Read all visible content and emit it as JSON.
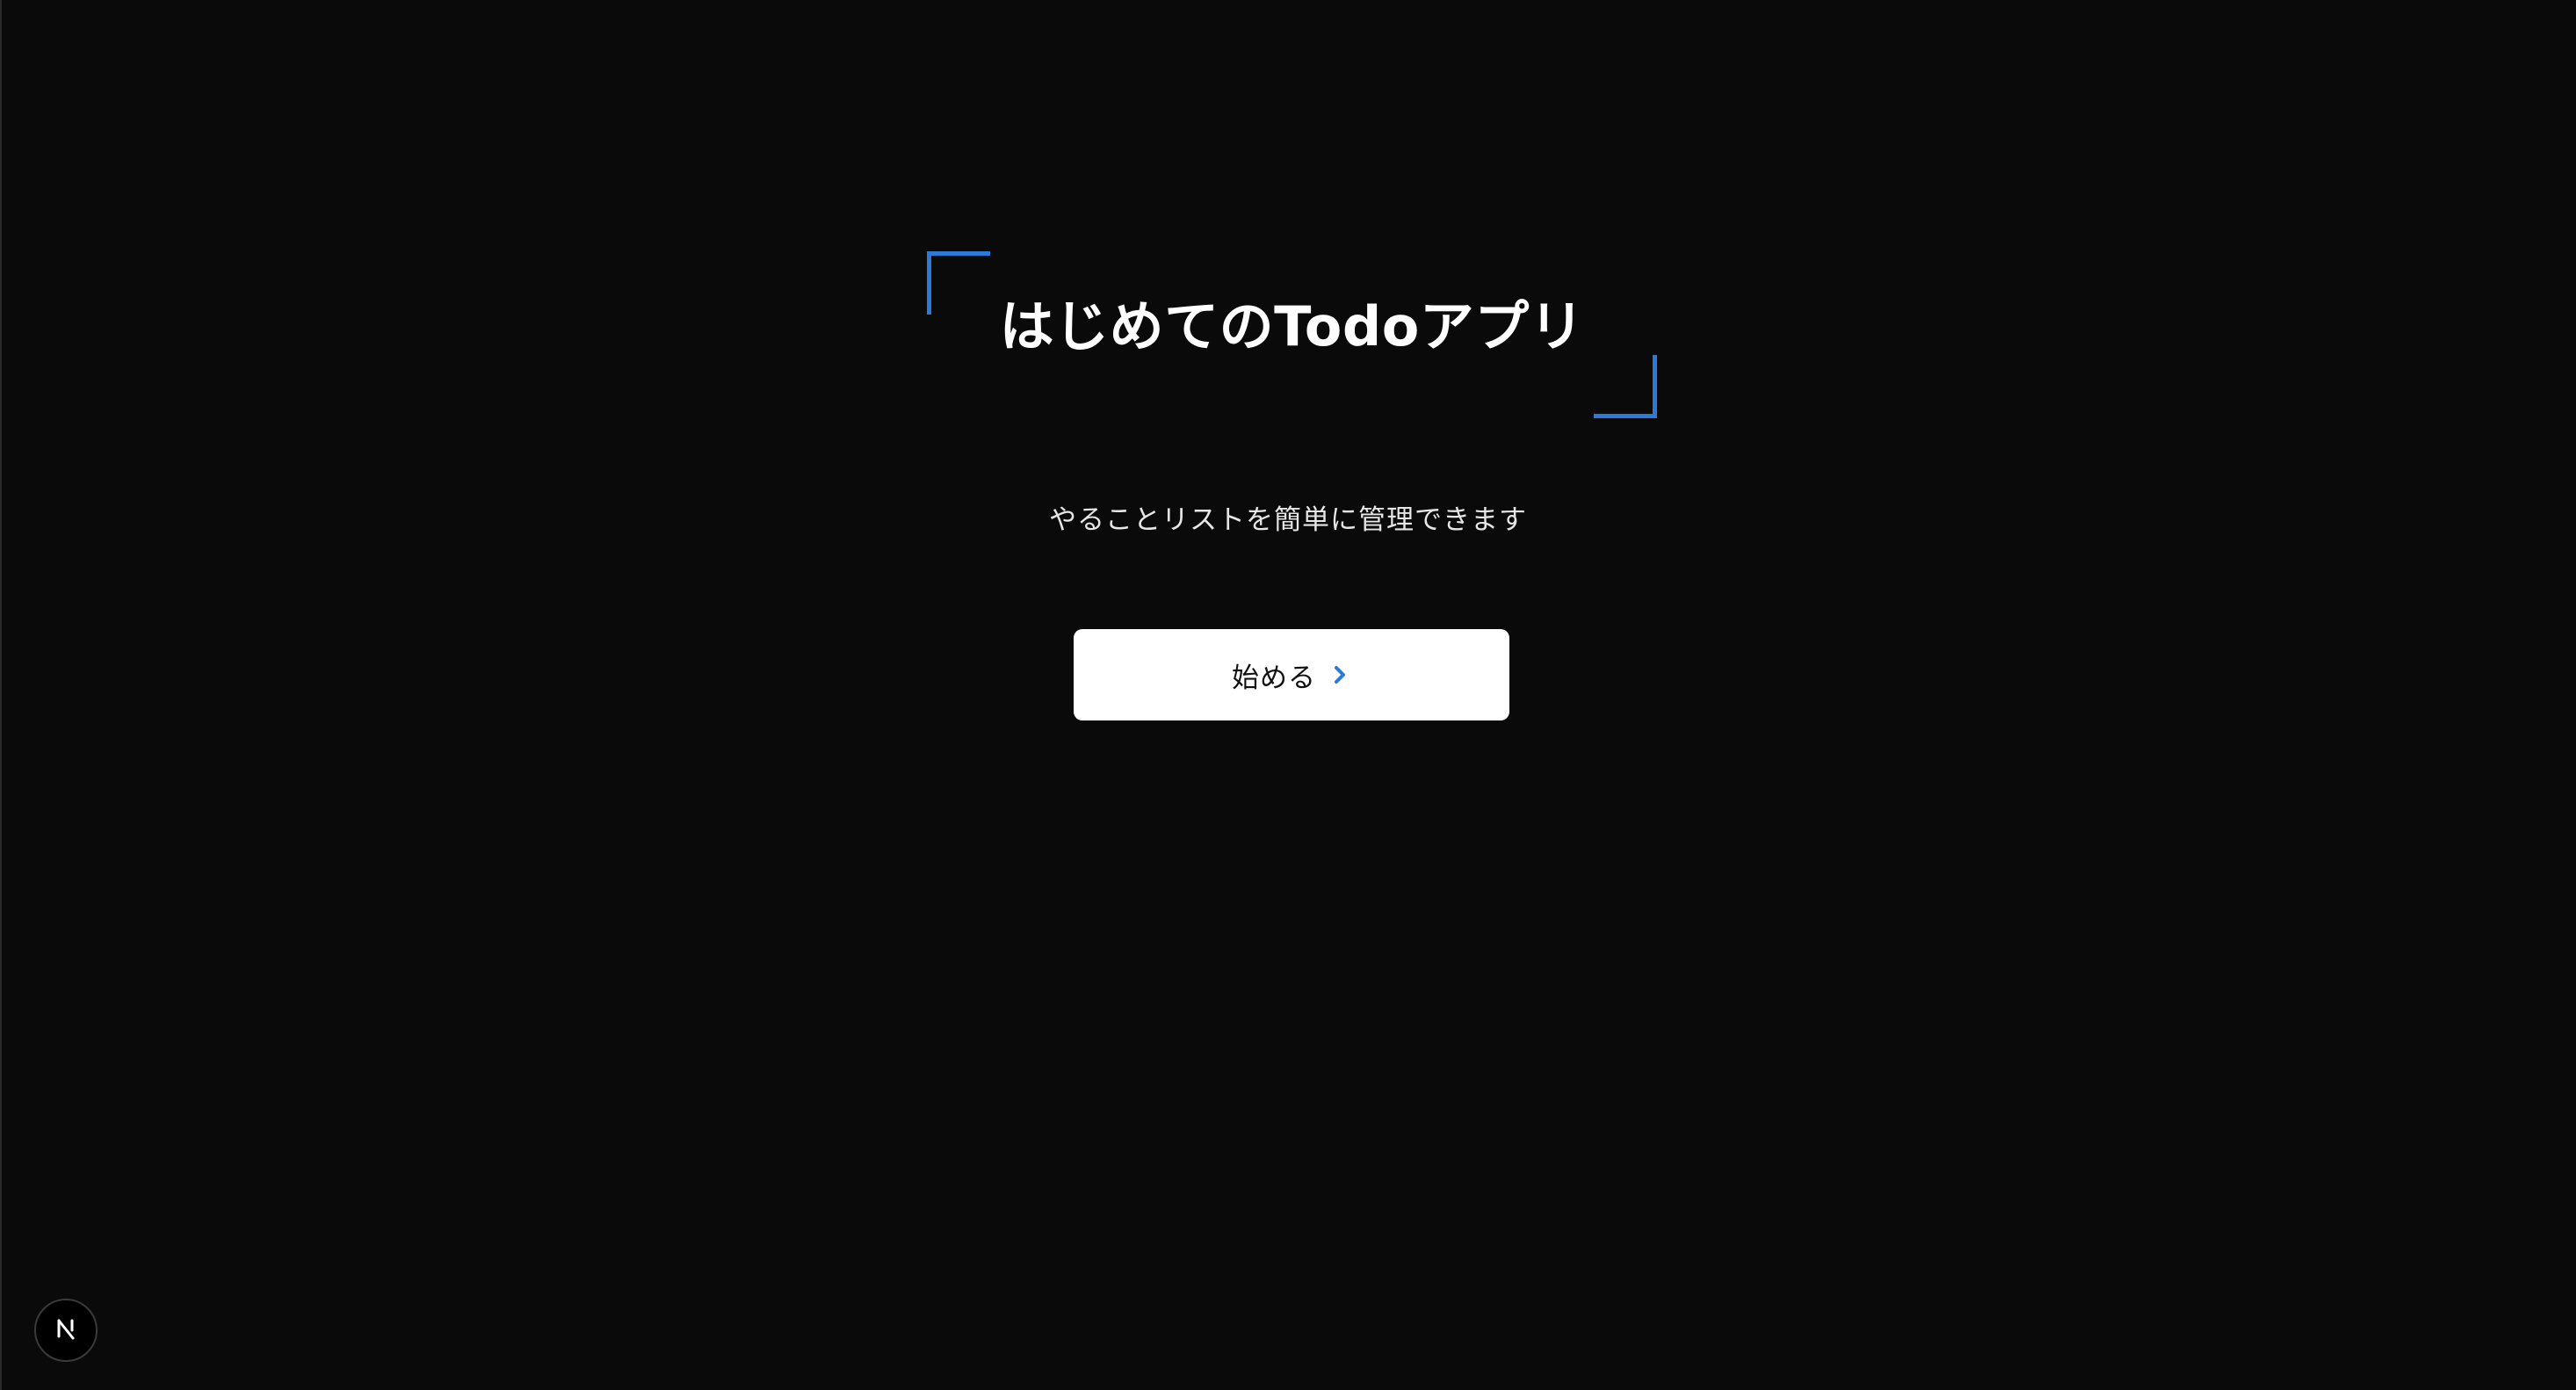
{
  "hero": {
    "title": "はじめてのTodoアプリ",
    "subtitle": "やることリストを簡単に管理できます"
  },
  "actions": {
    "start_label": "始める",
    "start_icon": "chevron-right-icon"
  },
  "dev_badge": {
    "icon": "nextjs-logo-icon",
    "letter": "N"
  },
  "colors": {
    "background": "#0a0a0a",
    "accent": "#2b7bd6",
    "button_bg": "#ffffff",
    "text": "#ffffff"
  }
}
